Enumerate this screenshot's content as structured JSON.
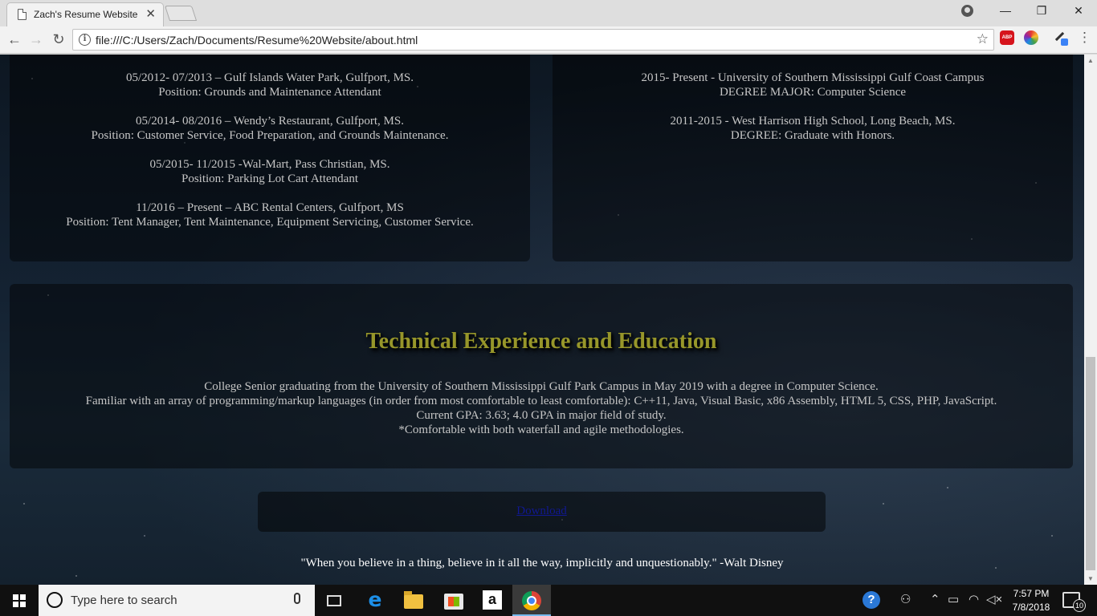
{
  "browser": {
    "tab_title": "Zach's Resume Website",
    "tab_close": "✕",
    "url": "file:///C:/Users/Zach/Documents/Resume%20Website/about.html",
    "abp_label": "ABP",
    "window_minimize": "—",
    "window_restore": "❐",
    "window_close": "✕"
  },
  "work_history": [
    {
      "line1": "05/2012- 07/2013 – Gulf Islands Water Park, Gulfport, MS.",
      "line2": "Position: Grounds and Maintenance Attendant"
    },
    {
      "line1": "05/2014- 08/2016 – Wendy’s Restaurant, Gulfport, MS.",
      "line2": "Position: Customer Service, Food Preparation, and Grounds Maintenance."
    },
    {
      "line1": "05/2015- 11/2015 -Wal-Mart, Pass Christian, MS.",
      "line2": "Position: Parking Lot Cart Attendant"
    },
    {
      "line1": "11/2016 – Present – ABC Rental Centers, Gulfport, MS",
      "line2": "Position: Tent Manager, Tent Maintenance, Equipment Servicing, Customer Service."
    }
  ],
  "education": [
    {
      "line1": "2015- Present - University of Southern Mississippi Gulf Coast Campus",
      "line2": "DEGREE MAJOR: Computer Science"
    },
    {
      "line1": "2011-2015 - West Harrison High School, Long Beach, MS.",
      "line2": "DEGREE: Graduate with Honors."
    }
  ],
  "technical": {
    "title": "Technical Experience and Education",
    "lines": [
      "College Senior graduating from the University of Southern Mississippi Gulf Park Campus in May 2019 with a degree in Computer Science.",
      "Familiar with an array of programming/markup languages (in order from most comfortable to least comfortable): C++11, Java, Visual Basic, x86 Assembly, HTML 5, CSS, PHP, JavaScript.",
      "Current GPA: 3.63; 4.0 GPA in major field of study.",
      "*Comfortable with both waterfall and agile methodologies."
    ]
  },
  "download_label": "Download",
  "quote": "\"When you believe in a thing, believe in it all the way, implicitly and unquestionably.\" -Walt Disney",
  "taskbar": {
    "search_placeholder": "Type here to search",
    "amazon_label": "a",
    "time": "7:57 PM",
    "date": "7/8/2018",
    "notification_count": "10"
  }
}
